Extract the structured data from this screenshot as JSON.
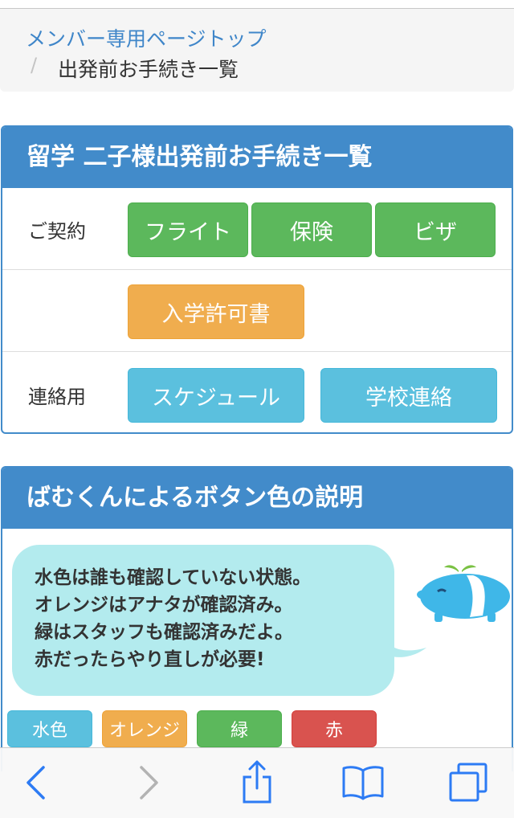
{
  "breadcrumb": {
    "link": "メンバー専用ページトップ",
    "separator": "/",
    "current": "出発前お手続き一覧"
  },
  "procedures_panel": {
    "title": "留学 二子様出発前お手続き一覧",
    "rows": [
      {
        "label": "ご契約",
        "buttons": [
          {
            "label": "フライト",
            "color": "green"
          },
          {
            "label": "保険",
            "color": "green"
          },
          {
            "label": "ビザ",
            "color": "green"
          }
        ]
      },
      {
        "label": "",
        "buttons": [
          {
            "label": "入学許可書",
            "color": "orange"
          }
        ]
      },
      {
        "label": "連絡用",
        "buttons": [
          {
            "label": "スケジュール",
            "color": "cyan"
          },
          {
            "label": "学校連絡",
            "color": "cyan"
          }
        ]
      }
    ]
  },
  "explanation_panel": {
    "title": "ばむくんによるボタン色の説明",
    "lines": [
      "水色は誰も確認していない状態。",
      "オレンジはアナタが確認済み。",
      "緑はスタッフも確認済みだよ。",
      "赤だったらやり直しが必要!"
    ],
    "legend": [
      {
        "label": "水色",
        "color": "cyan"
      },
      {
        "label": "オレンジ",
        "color": "orange"
      },
      {
        "label": "緑",
        "color": "green"
      },
      {
        "label": "赤",
        "color": "red"
      }
    ]
  },
  "colors": {
    "primary": "#428bca",
    "green": "#5cb85c",
    "orange": "#f0ad4e",
    "cyan": "#5bc0de",
    "red": "#d9534f",
    "bubble": "#b3ebee",
    "toolbar_icon": "#2d7bf4",
    "toolbar_icon_disabled": "#b3b3b3"
  },
  "toolbar": {
    "icons": [
      "chevron-left-icon",
      "chevron-right-icon",
      "share-icon",
      "bookmarks-icon",
      "tabs-icon"
    ]
  }
}
